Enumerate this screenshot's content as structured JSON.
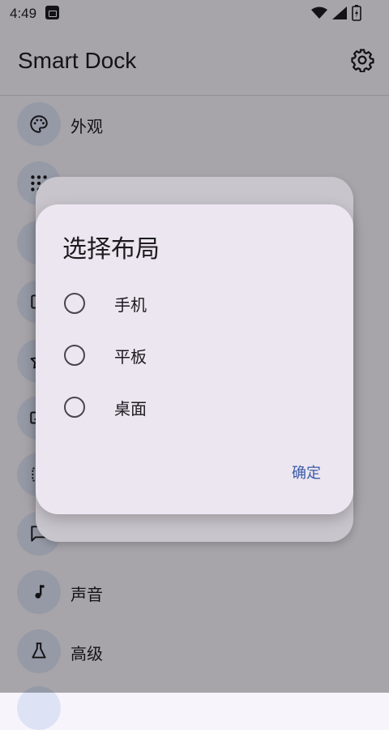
{
  "status": {
    "time": "4:49"
  },
  "appbar": {
    "title": "Smart Dock"
  },
  "list": [
    {
      "label": "外观",
      "icon": "palette-icon"
    },
    {
      "label": "",
      "icon": "apps-grid-icon"
    },
    {
      "label": "",
      "icon": "more-icon"
    },
    {
      "label": "",
      "icon": "window-icon"
    },
    {
      "label": "",
      "icon": "star-icon"
    },
    {
      "label": "",
      "icon": "keyboard-icon"
    },
    {
      "label": "",
      "icon": "crop-icon"
    },
    {
      "label": "",
      "icon": "message-icon"
    },
    {
      "label": "声音",
      "icon": "music-note-icon"
    },
    {
      "label": "高级",
      "icon": "flask-icon"
    }
  ],
  "dialog": {
    "title": "选择布局",
    "options": [
      "手机",
      "平板",
      "桌面"
    ],
    "confirm": "确定"
  },
  "colors": {
    "accent": "#3b5ba8",
    "dialog_bg": "#ece6f0"
  }
}
